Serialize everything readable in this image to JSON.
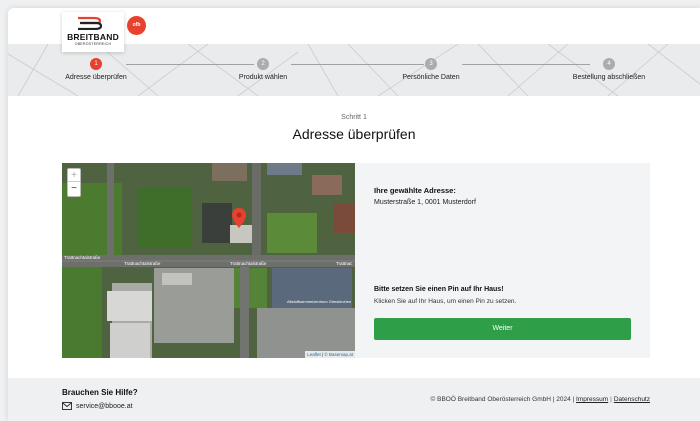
{
  "header": {
    "brand_name": "BREITBAND",
    "brand_sub": "OBERÖSTERREICH",
    "partner_logo_text": "ofb",
    "brand_color": "#e8412f"
  },
  "stepper": {
    "steps": [
      {
        "number": "1",
        "label": "Adresse überprüfen",
        "active": true
      },
      {
        "number": "2",
        "label": "Produkt wählen",
        "active": false
      },
      {
        "number": "3",
        "label": "Persönliche Daten",
        "active": false
      },
      {
        "number": "4",
        "label": "Bestellung abschließen",
        "active": false
      }
    ]
  },
  "main": {
    "kicker": "Schritt 1",
    "title": "Adresse überprüfen",
    "address_label": "Ihre gewählte Adresse:",
    "address_value": "Musterstraße 1, 0001 Musterdorf",
    "pin_title": "Bitte setzen Sie einen Pin auf Ihr Haus!",
    "pin_hint": "Klicken Sie auf Ihr Haus, um einen Pin zu setzen.",
    "next_button": "Weiter",
    "accent_color": "#2e9e48"
  },
  "map": {
    "zoom_in": "+",
    "zoom_out": "−",
    "attribution_leaflet": "Leaflet",
    "attribution_sep": "|",
    "attribution_basemap": "© Basemap.at",
    "street_labels": [
      "Trattnachtalstraße",
      "Trattnachtalstraße",
      "Trattnachtalstraße",
      "Trattnac"
    ],
    "building_label": "Altstoffsammelzentrum Grieskirchen"
  },
  "footer": {
    "help_title": "Brauchen Sie Hilfe?",
    "help_email": "service@bbooe.at",
    "copyright": "© BBOÖ Breitband Oberösterreich GmbH | 2024 |",
    "impressum": "Impressum",
    "separator": "|",
    "datenschutz": "Datenschutz"
  }
}
